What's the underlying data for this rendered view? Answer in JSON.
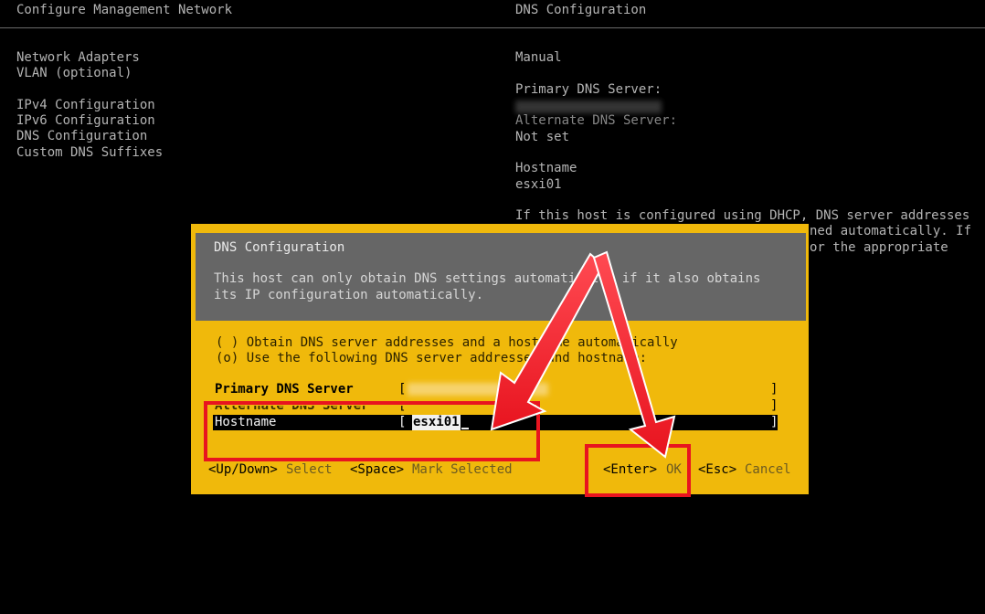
{
  "header": {
    "left_title": "Configure Management Network",
    "right_title": "DNS Configuration"
  },
  "nav": {
    "items": [
      "Network Adapters",
      "VLAN (optional)",
      "IPv4 Configuration",
      "IPv6 Configuration",
      "DNS Configuration",
      "Custom DNS Suffixes"
    ]
  },
  "summary": {
    "mode": "Manual",
    "primary_label": "Primary DNS Server:",
    "alternate_label": "Alternate DNS Server:",
    "alternate_value": "Not set",
    "hostname_label": "Hostname",
    "hostname_value": "esxi01",
    "info_line1": "If this host is configured using DHCP, DNS server addresses",
    "info_line2": "ned automatically. If",
    "info_line3": "or the appropriate"
  },
  "dialog": {
    "title": "DNS Configuration",
    "desc_line1": "This host can only obtain DNS settings automatically if it also obtains",
    "desc_line2": "its IP configuration automatically.",
    "option_auto": "( ) Obtain DNS server addresses and a hostname automatically",
    "option_manual": "(o) Use the following DNS server addresses and hostname:",
    "primary_label": "Primary DNS Server",
    "alternate_label": "Alternate DNS Server",
    "hostname_label": "Hostname",
    "hostname_value": "esxi01",
    "bracket_open": "[",
    "bracket_close": "]",
    "footer": {
      "select_key": "<Up/Down>",
      "select_label": "Select",
      "mark_key": "<Space>",
      "mark_label": "Mark Selected",
      "ok_key": "<Enter>",
      "ok_label": "OK",
      "cancel_key": "<Esc>",
      "cancel_label": "Cancel"
    }
  },
  "colors": {
    "background": "#000000",
    "dialog_yellow": "#f0b90b",
    "dialog_header_gray": "#666666",
    "annotation_red": "#e8141f"
  }
}
